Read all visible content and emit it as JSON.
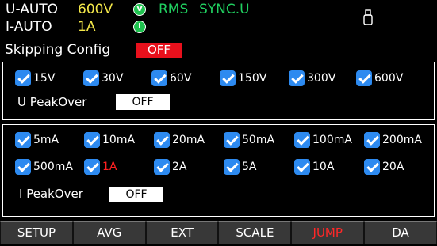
{
  "status": {
    "u_label": "U-AUTO",
    "u_value": "600V",
    "i_label": "I-AUTO",
    "i_value": "1A",
    "v_badge": "V",
    "i_badge": "I",
    "rms": "RMS",
    "sync": "SYNC.U",
    "usb_icon": "usb-icon",
    "colors": {
      "yellow": "#f4e84a",
      "green": "#20d060",
      "badge_green": "#1fc24f"
    }
  },
  "skipping": {
    "title": "Skipping Config",
    "state": "OFF",
    "state_color": "#e8101c"
  },
  "voltage": {
    "ranges": [
      {
        "label": "15V",
        "checked": true
      },
      {
        "label": "30V",
        "checked": true
      },
      {
        "label": "60V",
        "checked": true
      },
      {
        "label": "150V",
        "checked": true
      },
      {
        "label": "300V",
        "checked": true
      },
      {
        "label": "600V",
        "checked": true
      }
    ],
    "peakover_label": "U PeakOver",
    "peakover_value": "OFF"
  },
  "current": {
    "ranges": [
      {
        "label": "5mA",
        "checked": true
      },
      {
        "label": "10mA",
        "checked": true
      },
      {
        "label": "20mA",
        "checked": true
      },
      {
        "label": "50mA",
        "checked": true
      },
      {
        "label": "100mA",
        "checked": true
      },
      {
        "label": "200mA",
        "checked": true
      },
      {
        "label": "500mA",
        "checked": true
      },
      {
        "label": "1A",
        "checked": true,
        "highlight": true
      },
      {
        "label": "2A",
        "checked": true
      },
      {
        "label": "5A",
        "checked": true
      },
      {
        "label": "10A",
        "checked": true
      },
      {
        "label": "20A",
        "checked": true
      }
    ],
    "peakover_label": "I PeakOver",
    "peakover_value": "OFF"
  },
  "softkeys": [
    {
      "label": "SETUP"
    },
    {
      "label": "AVG"
    },
    {
      "label": "EXT"
    },
    {
      "label": "SCALE"
    },
    {
      "label": "JUMP",
      "active": true
    },
    {
      "label": "DA"
    }
  ],
  "accent": {
    "checkbox": "#2d8af0",
    "active_key": "#ff2828"
  }
}
